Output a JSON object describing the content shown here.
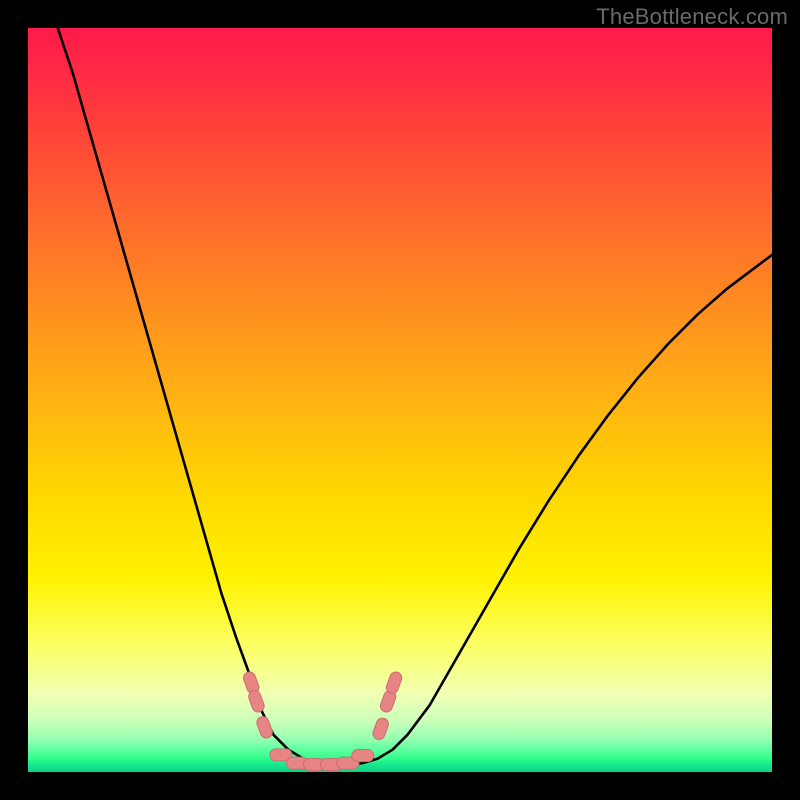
{
  "watermark": "TheBottleneck.com",
  "colors": {
    "frame": "#000000",
    "curve": "#000000",
    "marker_fill": "#e68583",
    "marker_stroke": "#c96f6e",
    "watermark": "#6a6a6a"
  },
  "chart_data": {
    "type": "line",
    "title": "",
    "xlabel": "",
    "ylabel": "",
    "xlim": [
      0,
      100
    ],
    "ylim": [
      0,
      100
    ],
    "note": "Axes are implicit (no tick labels visible). y-values are estimated percentages from curve height; 0 = bottom (green / good), 100 = top (red / bad). Two continuous curves share the flat trough.",
    "series": [
      {
        "name": "left_curve",
        "x": [
          4,
          6,
          8,
          10,
          12,
          14,
          16,
          18,
          20,
          22,
          24,
          26,
          28,
          30,
          31.5,
          33,
          35,
          37,
          39,
          41,
          43
        ],
        "y": [
          100,
          94,
          87,
          80,
          73,
          66,
          59,
          52,
          45,
          38,
          31,
          24,
          18,
          12.5,
          8,
          5,
          3,
          1.8,
          1.2,
          1,
          1
        ]
      },
      {
        "name": "right_curve",
        "x": [
          43,
          45,
          47,
          49,
          51,
          54,
          58,
          62,
          66,
          70,
          74,
          78,
          82,
          86,
          90,
          94,
          98,
          100
        ],
        "y": [
          1,
          1.2,
          1.8,
          3,
          5,
          9,
          16,
          23,
          30,
          36.5,
          42.5,
          48,
          53,
          57.5,
          61.5,
          65,
          68,
          69.5
        ]
      }
    ],
    "markers": {
      "note": "short salmon-colored bar/dash markers near the trough of the V",
      "points": [
        {
          "x": 30.0,
          "y": 12.0
        },
        {
          "x": 30.7,
          "y": 9.5
        },
        {
          "x": 31.8,
          "y": 6.0
        },
        {
          "x": 34.0,
          "y": 2.3
        },
        {
          "x": 36.2,
          "y": 1.2
        },
        {
          "x": 38.5,
          "y": 1.0
        },
        {
          "x": 40.8,
          "y": 1.0
        },
        {
          "x": 43.0,
          "y": 1.2
        },
        {
          "x": 45.0,
          "y": 2.2
        },
        {
          "x": 47.4,
          "y": 5.8
        },
        {
          "x": 48.4,
          "y": 9.5
        },
        {
          "x": 49.2,
          "y": 12.0
        }
      ]
    }
  }
}
